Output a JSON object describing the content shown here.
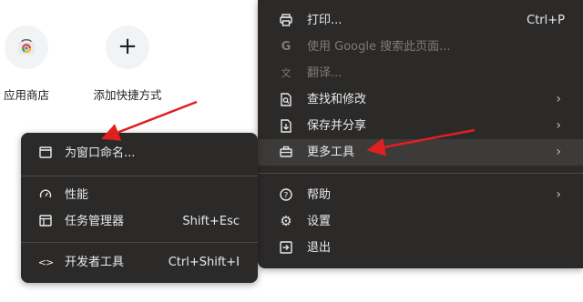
{
  "shortcuts": [
    {
      "label": "应用商店",
      "icon": "chrome-web-store-icon"
    },
    {
      "label": "添加快捷方式",
      "icon": "plus-icon"
    }
  ],
  "main_menu": {
    "items": [
      {
        "label": "打印...",
        "icon": "printer-icon",
        "shortcut": "Ctrl+P"
      },
      {
        "label": "使用 Google 搜索此页面...",
        "icon": "google-icon",
        "disabled": true
      },
      {
        "label": "翻译...",
        "icon": "translate-icon",
        "disabled": true
      },
      {
        "label": "查找和修改",
        "icon": "find-page-icon",
        "submenu": true
      },
      {
        "label": "保存并分享",
        "icon": "save-share-icon",
        "submenu": true
      },
      {
        "label": "更多工具",
        "icon": "toolbox-icon",
        "submenu": true,
        "active": true
      },
      {
        "label": "帮助",
        "icon": "help-icon",
        "submenu": true
      },
      {
        "label": "设置",
        "icon": "gear-icon"
      },
      {
        "label": "退出",
        "icon": "exit-icon"
      }
    ]
  },
  "more_tools_menu": {
    "items": [
      {
        "label": "为窗口命名...",
        "icon": "window-icon"
      },
      {
        "label": "性能",
        "icon": "gauge-icon"
      },
      {
        "label": "任务管理器",
        "icon": "task-manager-icon",
        "shortcut": "Shift+Esc"
      },
      {
        "label": "开发者工具",
        "icon": "code-icon",
        "shortcut": "Ctrl+Shift+I"
      }
    ]
  },
  "glyphs": {
    "plus": "+",
    "chevron": "›",
    "google_g": "G",
    "translate": "文",
    "help": "?",
    "gear": "⚙",
    "code": "<>"
  },
  "colors": {
    "menu_bg": "#2b2a29",
    "menu_active_bg": "#3c3b39",
    "menu_text": "#e8eaed",
    "menu_disabled_text": "#7c7b79",
    "annotation_arrow": "#e02020"
  }
}
